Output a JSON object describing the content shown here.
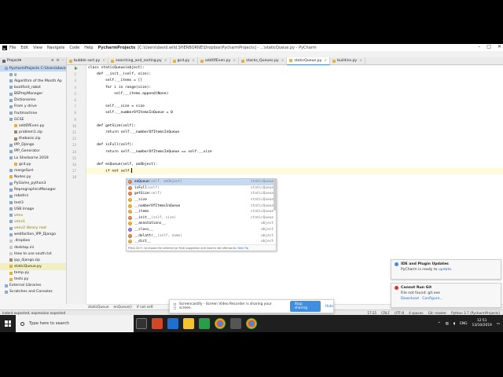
{
  "window": {
    "menu": [
      "File",
      "Edit",
      "View",
      "Navigate",
      "Code",
      "Help"
    ],
    "project": "PycharmProjects",
    "path": "[C:\\Users\\david.wild.SHERBORNE\\Dropbox\\PycharmProjects] - ...\\staticQueue.py - PyCharm"
  },
  "project_tab": {
    "label": "Project"
  },
  "editor_tabs": [
    "bubble sort.py",
    "searching_and_sorting.py",
    "gcd.py",
    "oddOfEven.py",
    "stacks_Queues.py",
    "staticQueue.py",
    "buildins.py"
  ],
  "active_tab": "staticQueue.py",
  "tree": [
    {
      "label": "PycharmProjects  C:\\Users\\david",
      "type": "folder",
      "indent": 0,
      "style": "selected"
    },
    {
      "label": "g",
      "type": "folder",
      "indent": 1
    },
    {
      "label": "Algorithm of the Month Ap",
      "type": "folder",
      "indent": 1
    },
    {
      "label": "bootford_robot",
      "type": "folder",
      "indent": 1
    },
    {
      "label": "BSPrepManager",
      "type": "folder",
      "indent": 1
    },
    {
      "label": "Dictionaries",
      "type": "folder",
      "indent": 1
    },
    {
      "label": "From y drive",
      "type": "folder",
      "indent": 1
    },
    {
      "label": "fruitmachine",
      "type": "folder",
      "indent": 1
    },
    {
      "label": "GCSE",
      "type": "folder",
      "indent": 1
    },
    {
      "label": "oddOfEven.py",
      "type": "file-py",
      "indent": 2
    },
    {
      "label": "problem1.zip",
      "type": "file-zip",
      "indent": 2
    },
    {
      "label": "thebasic.zip",
      "type": "file-zip",
      "indent": 2
    },
    {
      "label": "IPP_Django",
      "type": "folder",
      "indent": 1
    },
    {
      "label": "IPP_Generator",
      "type": "folder",
      "indent": 1
    },
    {
      "label": "Lo Sherborne 2019",
      "type": "folder",
      "indent": 1
    },
    {
      "label": "gcd.py",
      "type": "file-py",
      "indent": 2
    },
    {
      "label": "mergeSort",
      "type": "folder",
      "indent": 1
    },
    {
      "label": "Nodes.py",
      "type": "file-py",
      "indent": 1
    },
    {
      "label": "PyGame_python3",
      "type": "folder",
      "indent": 1
    },
    {
      "label": "ReprographicsManager",
      "type": "folder",
      "indent": 1
    },
    {
      "label": "robotics",
      "type": "folder",
      "indent": 1
    },
    {
      "label": "test3",
      "type": "folder",
      "indent": 1
    },
    {
      "label": "USB Image",
      "type": "folder",
      "indent": 1
    },
    {
      "label": "venv",
      "type": "folder",
      "indent": 1,
      "style": "olive"
    },
    {
      "label": "venv1",
      "type": "folder",
      "indent": 1,
      "style": "olive"
    },
    {
      "label": "venv2  library root",
      "type": "folder",
      "indent": 1,
      "style": "olive"
    },
    {
      "label": "webfaction_IPP_Django",
      "type": "folder",
      "indent": 1
    },
    {
      "label": ".dropbox",
      "type": "file-txt",
      "indent": 1
    },
    {
      "label": "desktop.ini",
      "type": "file-txt",
      "indent": 1
    },
    {
      "label": "How to use south.txt",
      "type": "file-txt",
      "indent": 1
    },
    {
      "label": "ipp_django.zip",
      "type": "file-zip",
      "indent": 1
    },
    {
      "label": "staticQueue.py",
      "type": "file-py",
      "indent": 1,
      "style": "vsel"
    },
    {
      "label": "temp.py",
      "type": "file-py",
      "indent": 1
    },
    {
      "label": "tests.py",
      "type": "file-py",
      "indent": 1
    },
    {
      "label": "External Libraries",
      "type": "folder",
      "indent": 0
    },
    {
      "label": "Scratches and Consoles",
      "type": "folder",
      "indent": 0
    }
  ],
  "line_numbers": [
    "1",
    "2",
    "3",
    "4",
    "5",
    "6",
    "7",
    "8",
    "9",
    "10",
    "11",
    "12",
    "13",
    "14",
    "15",
    "16",
    "17",
    "18"
  ],
  "code_lines": [
    "class staticQueue(object):",
    "    def __init__(self, size):",
    "        self.__items = []",
    "        for i in range(size):",
    "            self.__items.append(None)",
    "",
    "        self.__size = size",
    "        self.__numberOfItemsInQueue = 0",
    "",
    "    def getSize(self):",
    "        return self.__numberOfItemsInQueue",
    "",
    "    def isFull(self):",
    "        return self.__numberOfItemsInQueue == self.__size",
    "",
    "    def enQueue(self, anObject):",
    "        if not self.",
    ""
  ],
  "autocomplete": {
    "items": [
      {
        "kind": "m",
        "name": "enQueue",
        "params": "(self, anObject)",
        "owner": "staticQueue"
      },
      {
        "kind": "m",
        "name": "isFull",
        "params": "(self)",
        "owner": "staticQueue"
      },
      {
        "kind": "m",
        "name": "getSize",
        "params": "(self)",
        "owner": "staticQueue"
      },
      {
        "kind": "f",
        "name": "__size",
        "params": "",
        "owner": "staticQueue"
      },
      {
        "kind": "f",
        "name": "__numberOfItemsInQueue",
        "params": "",
        "owner": "staticQueue"
      },
      {
        "kind": "f",
        "name": "__items",
        "params": "",
        "owner": "staticQueue"
      },
      {
        "kind": "m",
        "name": "__init__",
        "params": "(self, size)",
        "owner": "staticQueue"
      },
      {
        "kind": "f",
        "name": "__annotations__",
        "params": "",
        "owner": "object"
      },
      {
        "kind": "p",
        "name": "__class__",
        "params": "",
        "owner": "object"
      },
      {
        "kind": "m",
        "name": "__delattr__",
        "params": "(self, name)",
        "owner": "object"
      },
      {
        "kind": "f",
        "name": "__dict__",
        "params": "",
        "owner": "object"
      },
      {
        "kind": "m",
        "name": "__dir__",
        "params": "(self)",
        "owner": "object"
      }
    ],
    "footer": "Press Ctrl+. to choose the selected (or first) suggestion and insert a dot afterwards",
    "footer_link": "Next Tip"
  },
  "breadcrumb": [
    "staticQueue",
    "enQueue()",
    "if not self."
  ],
  "status": {
    "left": "Indent expected, expression expected",
    "right": [
      "17:21",
      "CRLF",
      "UTF-8",
      "4 spaces",
      "Git: master",
      "Python 3.7 (PycharmProjects)"
    ]
  },
  "share_bar": {
    "text": "Screencastify - Screen Video Recorder is sharing your screen.",
    "stop_label": "Stop sharing",
    "hide_label": "Hide"
  },
  "notifications": [
    {
      "title": "IDE and Plugin Updates",
      "body": "PyCharm is ready to ",
      "link": "update.",
      "color": "#3f8ee0"
    },
    {
      "title": "Cannot Run Git",
      "body": "File not found: git.exe",
      "links": [
        "Download",
        "Configure..."
      ],
      "color": "#d9342b"
    }
  ],
  "taskbar": {
    "search_placeholder": "Type here to search",
    "lang": "ENG",
    "time": "12:51",
    "date": "13/10/2019"
  }
}
